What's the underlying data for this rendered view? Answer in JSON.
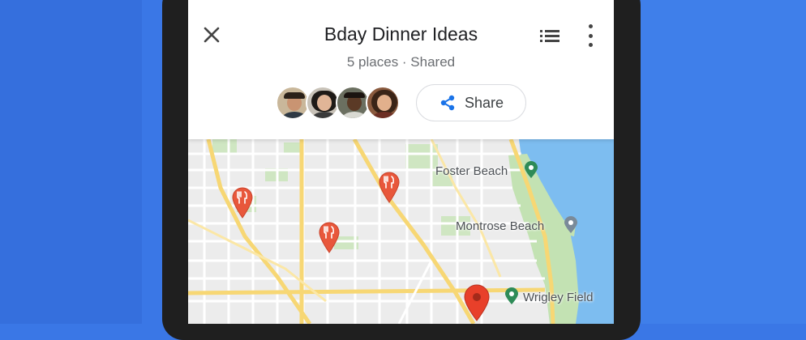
{
  "list": {
    "title": "Bday Dinner Ideas",
    "subtitle": "5 places · Shared",
    "share_label": "Share"
  },
  "toolbar": {
    "close_icon": "close-icon",
    "list_icon": "list-view-icon",
    "more_icon": "more-vert-icon"
  },
  "collaborators": [
    {
      "icon": "avatar-1"
    },
    {
      "icon": "avatar-2"
    },
    {
      "icon": "avatar-3"
    },
    {
      "icon": "avatar-4"
    }
  ],
  "map": {
    "labels": {
      "foster_beach": "Foster Beach",
      "montrose_beach": "Montrose Beach",
      "wrigley_field": "Wrigley Field"
    },
    "colors": {
      "water": "#7dbdf0",
      "park": "#c3e2b3",
      "major_road": "#f7d774",
      "pin": "#e8573b",
      "place_marker_green": "#2e8b57",
      "place_marker_gray": "#7a8a99"
    }
  },
  "colors": {
    "background": "#3a77e6",
    "accent": "#1a73e8"
  }
}
